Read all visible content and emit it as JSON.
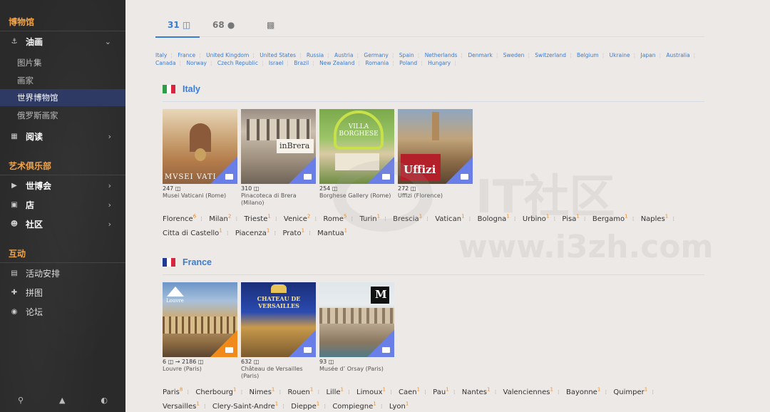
{
  "sidebar": {
    "sections": [
      {
        "title": "博物馆"
      },
      {
        "title": "艺术俱乐部"
      },
      {
        "title": "互动"
      }
    ],
    "painting": {
      "label": "油画",
      "icon": "museum-icon"
    },
    "painting_items": [
      "图片集",
      "画家",
      "世界博物馆",
      "俄罗斯画家"
    ],
    "reading": {
      "label": "阅读",
      "icon": "book-icon"
    },
    "club_items": [
      {
        "label": "世博会",
        "icon": "play-icon"
      },
      {
        "label": "店",
        "icon": "shop-icon"
      },
      {
        "label": "社区",
        "icon": "users-icon"
      }
    ],
    "interact_items": [
      {
        "label": "活动安排",
        "icon": "calendar-icon"
      },
      {
        "label": "拼图",
        "icon": "puzzle-icon"
      },
      {
        "label": "论坛",
        "icon": "comments-icon"
      }
    ],
    "bottom_icons": [
      "search-icon",
      "sitemap-icon",
      "contrast-icon"
    ]
  },
  "tabs": [
    {
      "label": "31",
      "icon": "gallery-icon"
    },
    {
      "label": "68",
      "icon": "comment-icon"
    },
    {
      "label": "",
      "icon": "book-icon"
    }
  ],
  "country_links": [
    "Italy",
    "France",
    "United Kingdom",
    "United States",
    "Russia",
    "Austria",
    "Germany",
    "Spain",
    "Netherlands",
    "Denmark",
    "Sweden",
    "Switzerland",
    "Belgium",
    "Ukraine",
    "Japan",
    "Australia",
    "Canada",
    "Norway",
    "Czech Republic",
    "Israel",
    "Brazil",
    "New Zealand",
    "Romania",
    "Poland",
    "Hungary"
  ],
  "countries": [
    {
      "name": "Italy",
      "flag": [
        "#2e9e48",
        "#ffffff",
        "#d7263d"
      ],
      "museums": [
        {
          "count": "247",
          "caption": "Musei Vaticani (Rome)",
          "tile_text": "MVSEI VATI"
        },
        {
          "count": "310",
          "caption": "Pinacoteca di Brera (Milano)",
          "tile_text": "inBrera"
        },
        {
          "count": "254",
          "caption": "Borghese Gallery (Rome)",
          "tile_text": "VILLA BORGHESE"
        },
        {
          "count": "272",
          "caption": "Uffizi (Florence)",
          "tile_text": "Uffizi"
        }
      ],
      "cities": [
        {
          "name": "Florence",
          "n": "6"
        },
        {
          "name": "Milan",
          "n": "2"
        },
        {
          "name": "Trieste",
          "n": "1"
        },
        {
          "name": "Venice",
          "n": "2"
        },
        {
          "name": "Rome",
          "n": "5"
        },
        {
          "name": "Turin",
          "n": "1"
        },
        {
          "name": "Brescia",
          "n": "1"
        },
        {
          "name": "Vatican",
          "n": "1"
        },
        {
          "name": "Bologna",
          "n": "1"
        },
        {
          "name": "Urbino",
          "n": "1"
        },
        {
          "name": "Pisa",
          "n": "1"
        },
        {
          "name": "Bergamo",
          "n": "1"
        },
        {
          "name": "Naples",
          "n": "1"
        },
        {
          "name": "Citta di Castello",
          "n": "1"
        },
        {
          "name": "Piacenza",
          "n": "1"
        },
        {
          "name": "Prato",
          "n": "1"
        },
        {
          "name": "Mantua",
          "n": "1"
        }
      ]
    },
    {
      "name": "France",
      "flag": [
        "#1f3a93",
        "#ffffff",
        "#d7263d"
      ],
      "museums": [
        {
          "count": "6",
          "count2": "2186",
          "caption": "Louvre (Paris)",
          "tile_text": "Louvre"
        },
        {
          "count": "632",
          "caption": "Château de Versailles (Paris)",
          "tile_text": "CHATEAU DE VERSAILLES"
        },
        {
          "count": "93",
          "caption": "Musée d’ Orsay (Paris)",
          "tile_text": "M"
        }
      ],
      "cities": [
        {
          "name": "Paris",
          "n": "8"
        },
        {
          "name": "Cherbourg",
          "n": "1"
        },
        {
          "name": "Nimes",
          "n": "1"
        },
        {
          "name": "Rouen",
          "n": "1"
        },
        {
          "name": "Lille",
          "n": "1"
        },
        {
          "name": "Limoux",
          "n": "1"
        },
        {
          "name": "Caen",
          "n": "1"
        },
        {
          "name": "Pau",
          "n": "1"
        },
        {
          "name": "Nantes",
          "n": "1"
        },
        {
          "name": "Valenciennes",
          "n": "1"
        },
        {
          "name": "Bayonne",
          "n": "1"
        },
        {
          "name": "Quimper",
          "n": "1"
        },
        {
          "name": "Versailles",
          "n": "1"
        },
        {
          "name": "Clery-Saint-Andre",
          "n": "1"
        },
        {
          "name": "Dieppe",
          "n": "1"
        },
        {
          "name": "Compiegne",
          "n": "1"
        },
        {
          "name": "Lyon",
          "n": "1"
        }
      ]
    }
  ],
  "watermark": {
    "cn": "IT社区",
    "url": "www.i3zh.com"
  }
}
